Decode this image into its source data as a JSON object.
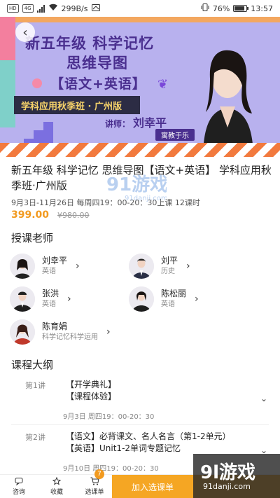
{
  "status_bar": {
    "hd": "HD",
    "network": "4G",
    "speed": "299B/s",
    "battery": "76%",
    "time": "13:57"
  },
  "banner": {
    "title_line1": "新五年级 科学记忆",
    "title_line2": "思维导图",
    "title_line3": "【语文+英语】",
    "subtitle": "学科应用秋季班 · 广州版",
    "teacher_prefix": "讲师：",
    "teacher_name": "刘幸平",
    "org": "寓教于乐"
  },
  "course": {
    "title": "新五年级 科学记忆 思维导图【语文+英语】 学科应用秋季班·广州版",
    "meta": "9月3日-11月26日 每周四19：00-20：30上课 12课时",
    "price": "399.00",
    "original_price": "¥980.00"
  },
  "watermark_mid": {
    "logo": "91游戏",
    "url": "91danji.com"
  },
  "teachers_section": {
    "heading": "授课老师",
    "teachers": [
      {
        "name": "刘幸平",
        "subject": "英语"
      },
      {
        "name": "刘平",
        "subject": "历史"
      },
      {
        "name": "张洪",
        "subject": "英语"
      },
      {
        "name": "陈松丽",
        "subject": "英语"
      },
      {
        "name": "陈育娟",
        "subject": "科学记忆科学运用"
      }
    ]
  },
  "syllabus": {
    "heading": "课程大纲",
    "lessons": [
      {
        "num": "第1讲",
        "line1": "【开学典礼】",
        "line2": "【课程体验】",
        "time": "9月3日 周四19：00-20：30"
      },
      {
        "num": "第2讲",
        "line1": "【语文】必背课文、名人名言（第1-2单元）",
        "line2": "【英语】Unit1-2单词专题记忆",
        "time": "9月10日 周四19：00-20：30"
      }
    ]
  },
  "bottom_bar": {
    "consult": "咨询",
    "favorite": "收藏",
    "cart": "选课单",
    "cart_count": "7",
    "join": "加入选课单"
  },
  "watermark_corner": {
    "logo": "9l游戏",
    "url": "91danji.com"
  },
  "colors": {
    "accent": "#f29a1f",
    "banner_purple": "#b8b1ee",
    "title_purple": "#4a2f8f"
  }
}
